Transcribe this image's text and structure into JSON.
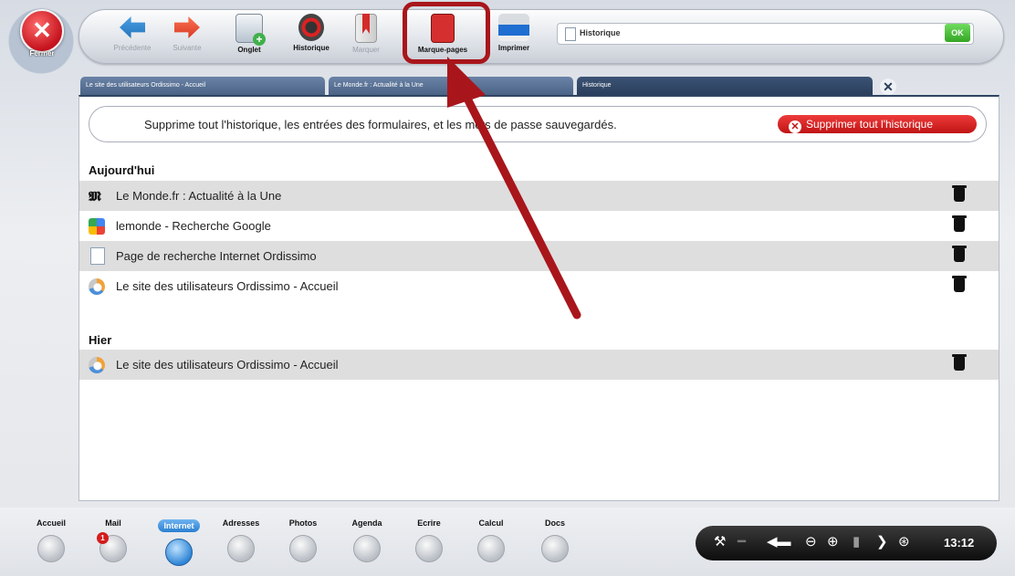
{
  "window": {
    "close_label": "Fermer"
  },
  "toolbar": {
    "buttons": [
      {
        "label": "Précédente",
        "icon": "back-arrow-icon",
        "enabled": false
      },
      {
        "label": "Suivante",
        "icon": "forward-arrow-icon",
        "enabled": false
      },
      {
        "label": "Onglet",
        "icon": "new-tab-icon",
        "enabled": true
      },
      {
        "label": "Historique",
        "icon": "history-icon",
        "enabled": true
      },
      {
        "label": "Marquer",
        "icon": "bookmark-add-icon",
        "enabled": false
      },
      {
        "label": "Marque-pages",
        "icon": "bookmarks-icon",
        "enabled": true
      },
      {
        "label": "Imprimer",
        "icon": "printer-icon",
        "enabled": true
      }
    ],
    "address_value": "Historique",
    "ok_label": "OK"
  },
  "tabs": [
    {
      "label": "Le site des utilisateurs Ordissimo - Accueil",
      "active": false
    },
    {
      "label": "Le Monde.fr : Actualité à la Une",
      "active": false
    },
    {
      "label": "Historique",
      "active": true
    }
  ],
  "history": {
    "notice": "Supprime tout l'historique, les entrées des formulaires, et les mots de passe sauvegardés.",
    "delete_all_label": "Supprimer tout l'historique",
    "sections": [
      {
        "heading": "Aujourd'hui",
        "items": [
          {
            "title": "Le Monde.fr : Actualité à la Une",
            "icon": "lemonde-favicon"
          },
          {
            "title": "lemonde - Recherche Google",
            "icon": "google-favicon"
          },
          {
            "title": "Page de recherche Internet Ordissimo",
            "icon": "page-icon"
          },
          {
            "title": "Le site des utilisateurs Ordissimo - Accueil",
            "icon": "ordissimo-favicon"
          }
        ]
      },
      {
        "heading": "Hier",
        "items": [
          {
            "title": "Le site des utilisateurs Ordissimo - Accueil",
            "icon": "ordissimo-favicon"
          }
        ]
      }
    ]
  },
  "dock": {
    "apps": [
      {
        "label": "Accueil"
      },
      {
        "label": "Mail",
        "badge": "1"
      },
      {
        "label": "Internet",
        "selected": true
      },
      {
        "label": "Adresses"
      },
      {
        "label": "Photos"
      },
      {
        "label": "Agenda"
      },
      {
        "label": "Ecrire"
      },
      {
        "label": "Calcul"
      },
      {
        "label": "Docs"
      }
    ],
    "clock": "13:12"
  },
  "colors": {
    "highlight_red": "#a8161b",
    "delete_red": "#d41c1c",
    "tab_blue": "#4a6386"
  }
}
